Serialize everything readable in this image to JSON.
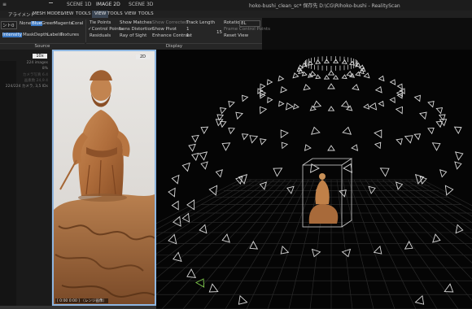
{
  "titlebar": {
    "icon_text": "≡",
    "tabs": [
      "SCENE 1D",
      "IMAGE 2D",
      "SCENE 3D"
    ],
    "title": "hoko-bushi_clean_sc* 保存先 D:\\CG\\RIhoko-bushi - RealityScan"
  },
  "menubar": {
    "items": [
      "アライメント",
      "MESH MODEL",
      "VIEW",
      "TOOLS",
      "VIEW",
      "TOOLS",
      "VIEW",
      "TOOLS"
    ],
    "active_index": 3
  },
  "ribbon": {
    "source": {
      "dropdown_value": "ント0",
      "channels": [
        "None",
        "Blue",
        "Green",
        "Magenta",
        "Coral"
      ],
      "channels_active": "Blue",
      "modes": [
        "Intensity",
        "Mask",
        "Depth",
        "Labels",
        "Textures"
      ],
      "section_label": "Source"
    },
    "display": {
      "col1": [
        "Tie Points",
        "✓Control Points",
        "Residuals"
      ],
      "col2": [
        "Show Matches",
        "Lens Distortion",
        "Ray of Sight"
      ],
      "col3": [
        "Show Corrected",
        "Show Pivot",
        "Enhance Contrast"
      ],
      "col4": [
        "Track Length",
        "1",
        "1"
      ],
      "col4_value": "15",
      "col5": [
        "Rotation",
        "Frame Control Points",
        "Reset View"
      ],
      "rotation_value": "8L",
      "section_label": "Display"
    }
  },
  "leftpanel": {
    "zoom_value": "10x",
    "info_lines": [
      "224 images",
      "8%",
      "カメラ写真 6.4",
      "画素数 24,9 4",
      "224/224 カメラ, 3,5 IDs"
    ]
  },
  "image2d": {
    "zoom_value": "2D",
    "bottom_label": "[ 0:00 0:00 ]  （レンジ画像）"
  },
  "colors": {
    "accent_blue": "#3a78c4",
    "image_border": "#8fb6e0",
    "grid_line": "#2a2a2a",
    "camera_cone": "#d9d9d9",
    "selected_camera": "#7ec84b"
  }
}
